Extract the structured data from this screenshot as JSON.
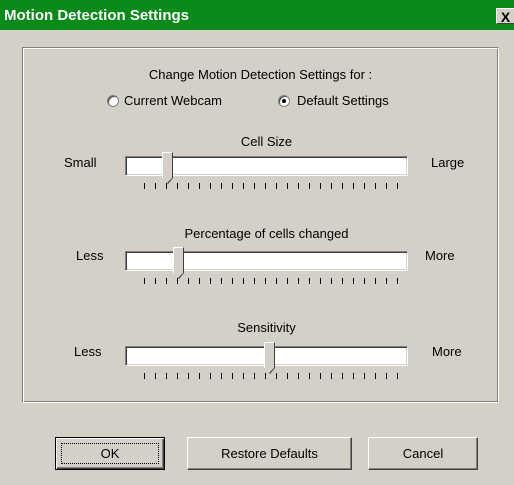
{
  "window": {
    "title": "Motion Detection Settings",
    "close_glyph": "X"
  },
  "header": {
    "prompt": "Change Motion Detection Settings for :"
  },
  "radios": {
    "current_webcam": {
      "label": "Current Webcam",
      "selected": false
    },
    "default_settings": {
      "label": "Default Settings",
      "selected": true
    }
  },
  "sliders": {
    "cell_size": {
      "title": "Cell Size",
      "min_label": "Small",
      "max_label": "Large",
      "value_fraction": 0.15
    },
    "cells_changed": {
      "title": "Percentage of cells changed",
      "min_label": "Less",
      "max_label": "More",
      "value_fraction": 0.18
    },
    "sensitivity": {
      "title": "Sensitivity",
      "min_label": "Less",
      "max_label": "More",
      "value_fraction": 0.5
    }
  },
  "buttons": {
    "ok": "OK",
    "restore": "Restore Defaults",
    "cancel": "Cancel"
  },
  "colors": {
    "titlebar": "#0a8a1a",
    "face": "#d4d0c8"
  }
}
